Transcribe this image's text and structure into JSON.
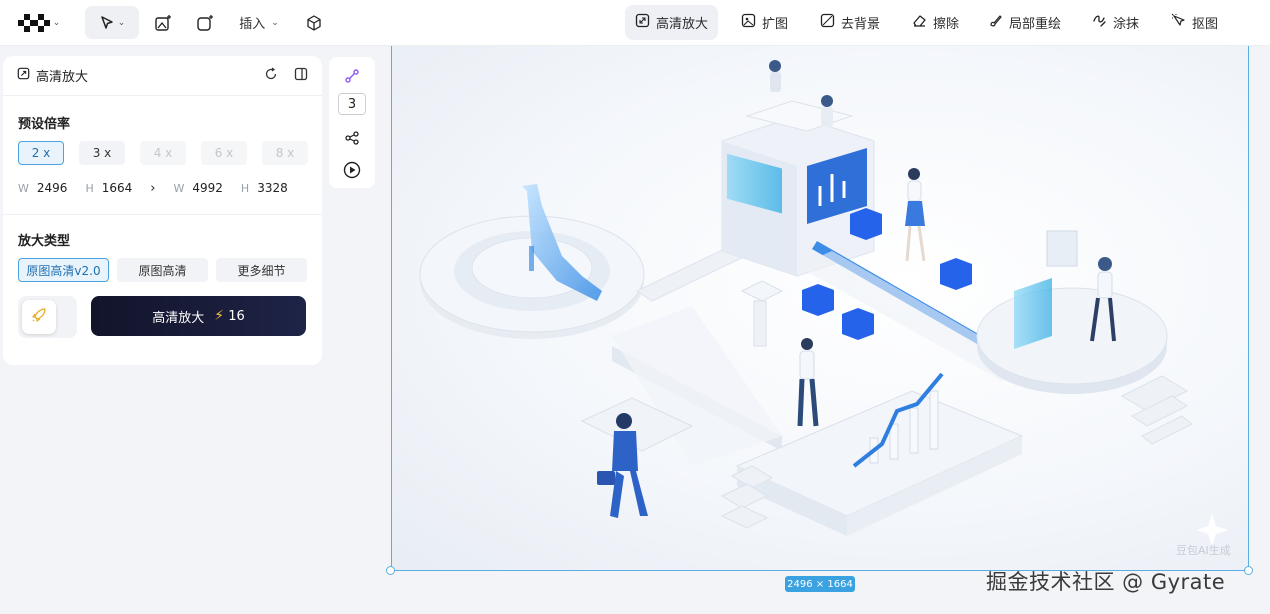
{
  "toolbar": {
    "insert_label": "插入",
    "tools": [
      {
        "label": "高清放大",
        "icon": "hd-upscale-icon",
        "active": true
      },
      {
        "label": "扩图",
        "icon": "expand-image-icon",
        "active": false
      },
      {
        "label": "去背景",
        "icon": "remove-background-icon",
        "active": false
      },
      {
        "label": "擦除",
        "icon": "eraser-icon",
        "active": false
      },
      {
        "label": "局部重绘",
        "icon": "inpaint-brush-icon",
        "active": false
      },
      {
        "label": "涂抹",
        "icon": "smudge-icon",
        "active": false
      },
      {
        "label": "抠图",
        "icon": "cutout-icon",
        "active": false
      }
    ]
  },
  "panel": {
    "title": "高清放大",
    "preset_label": "预设倍率",
    "scales": [
      {
        "label": "2 x",
        "state": "selected"
      },
      {
        "label": "3 x",
        "state": "normal"
      },
      {
        "label": "4 x",
        "state": "disabled"
      },
      {
        "label": "6 x",
        "state": "disabled"
      },
      {
        "label": "8 x",
        "state": "disabled"
      }
    ],
    "dims": {
      "w_label": "W",
      "h_label": "H",
      "src_w": "2496",
      "src_h": "1664",
      "dst_w": "4992",
      "dst_h": "3328"
    },
    "type_label": "放大类型",
    "types": [
      {
        "label": "原图高清v2.0",
        "selected": true
      },
      {
        "label": "原图高清",
        "selected": false
      },
      {
        "label": "更多细节",
        "selected": false
      }
    ],
    "action_label": "高清放大",
    "action_cost": "16"
  },
  "vbar": {
    "count": "3"
  },
  "canvas": {
    "size_badge": "2496 × 1664",
    "watermark_ai": "豆包AI生成",
    "watermark_site": "掘金技术社区 @ Gyrate"
  },
  "colors": {
    "accent": "#3aa2e0",
    "selection_border": "#5aaee3",
    "action_dark": "#151831",
    "bolt": "#f5c33b"
  }
}
